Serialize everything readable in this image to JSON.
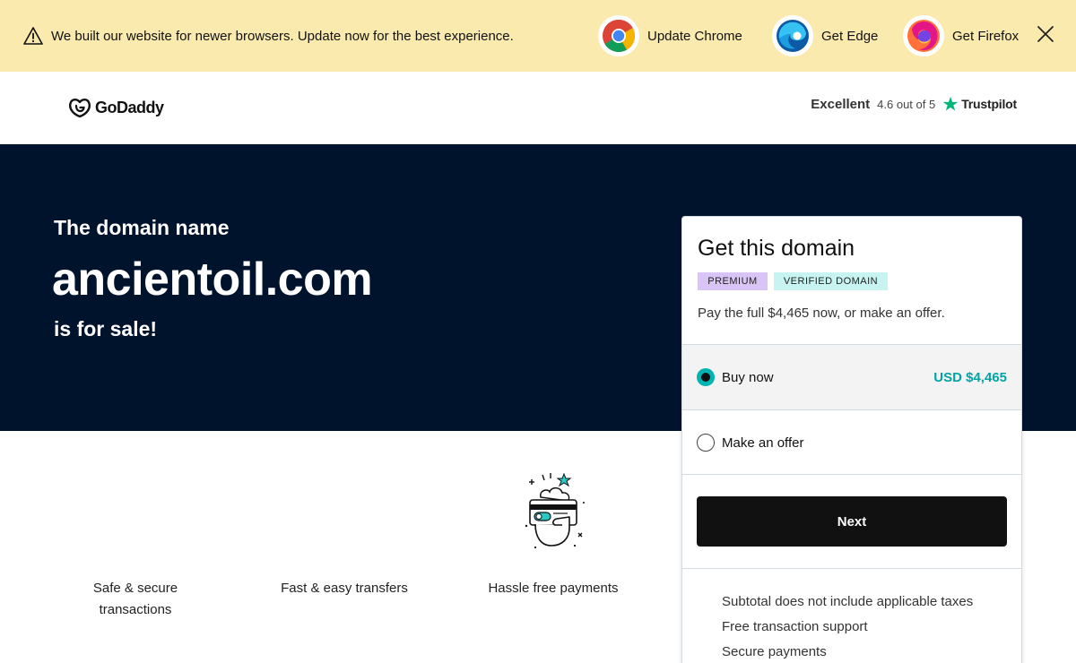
{
  "banner": {
    "message": "We built our website for newer browsers. Update now for the best experience.",
    "browsers": [
      {
        "label": "Update Chrome",
        "icon": "chrome-icon"
      },
      {
        "label": "Get Edge",
        "icon": "edge-icon"
      },
      {
        "label": "Get Firefox",
        "icon": "firefox-icon"
      }
    ],
    "close_icon": "close-icon",
    "background": "#fbeaae"
  },
  "header": {
    "logo_text": "GoDaddy",
    "trust": {
      "rating": "Excellent",
      "score": "4.6 out of 5",
      "brand": "Trustpilot",
      "star_color": "#00b67a"
    }
  },
  "hero": {
    "eyebrow": "The domain name",
    "domain": "ancientoil.com",
    "subtitle": "is for sale!",
    "background": "#00132d"
  },
  "features": [
    {
      "label": "Safe & secure transactions"
    },
    {
      "label": "Fast & easy transfers"
    },
    {
      "label": "Hassle free payments"
    }
  ],
  "card": {
    "title": "Get this domain",
    "badges": [
      "PREMIUM",
      "VERIFIED DOMAIN"
    ],
    "description": "Pay the full $4,465 now, or make an offer.",
    "options": [
      {
        "label": "Buy now",
        "price": "USD $4,465",
        "selected": true
      },
      {
        "label": "Make an offer",
        "selected": false
      }
    ],
    "next_label": "Next",
    "info": [
      "Subtotal does not include applicable taxes",
      "Free transaction support",
      "Secure payments"
    ],
    "accent": "#00a4a6"
  }
}
